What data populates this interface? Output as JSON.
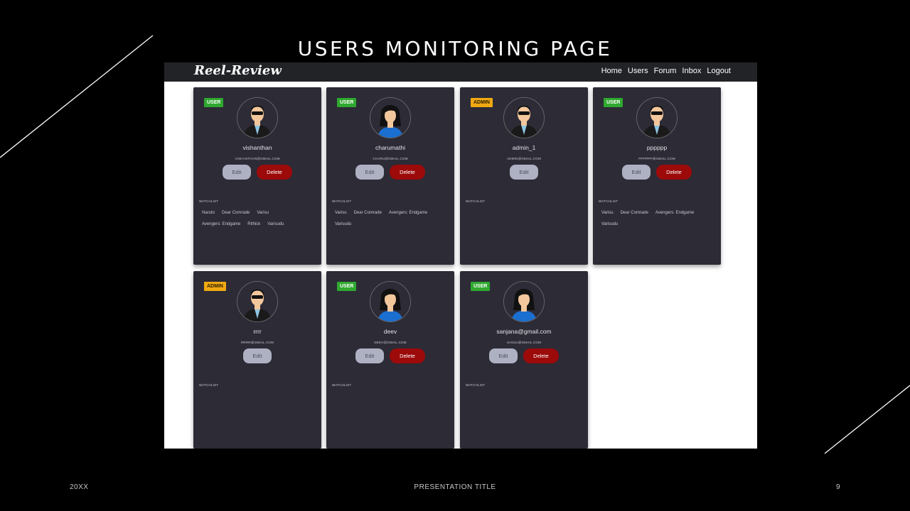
{
  "slide": {
    "title": "USERS MONITORING PAGE",
    "footer_left": "20XX",
    "footer_center": "PRESENTATION TITLE",
    "footer_right": "9"
  },
  "app": {
    "brand": "Reel-Review",
    "nav": [
      "Home",
      "Users",
      "Forum",
      "Inbox",
      "Logout"
    ],
    "edit_label": "Edit",
    "delete_label": "Delete",
    "watchlist_label": "WATCHLIST"
  },
  "users": [
    {
      "role": "USER",
      "avatar": "male-avatar-icon",
      "name": "vishanthan",
      "email": "VISHANTHAN@GMAIL.COM",
      "can_delete": true,
      "watchlist": [
        "Naruto",
        "Dear Comrade",
        "Varisu",
        "Avengers: Endgame",
        "Rithick",
        "Varisudu"
      ]
    },
    {
      "role": "USER",
      "avatar": "female-avatar-icon",
      "name": "charumathi",
      "email": "CHARU@GMAIL.COM",
      "can_delete": true,
      "watchlist": [
        "Varisu",
        "Dear Comrade",
        "Avengers: Endgame",
        "Varisudu"
      ]
    },
    {
      "role": "ADMIN",
      "avatar": "male-avatar-icon",
      "name": "admin_1",
      "email": "ADMIN@GMAIL.COM",
      "can_delete": false,
      "watchlist": []
    },
    {
      "role": "USER",
      "avatar": "male-avatar-icon",
      "name": "pppppp",
      "email": "PPPPPP@GMAIL.COM",
      "can_delete": true,
      "watchlist": [
        "Varisu",
        "Dear Comrade",
        "Avengers: Endgame",
        "Varisudu"
      ]
    },
    {
      "role": "ADMIN",
      "avatar": "male-avatar-icon",
      "name": "rrrr",
      "email": "RRRR@GMAIL.COM",
      "can_delete": false,
      "watchlist": []
    },
    {
      "role": "USER",
      "avatar": "female-avatar-icon",
      "name": "deev",
      "email": "DEEV@GMAIL.COM",
      "can_delete": true,
      "watchlist": []
    },
    {
      "role": "USER",
      "avatar": "female-avatar-icon",
      "name": "sanjana@gmail.com",
      "email": "SANJU@GMAIL.COM",
      "can_delete": true,
      "watchlist": []
    }
  ],
  "colors": {
    "slide_bg": "#000000",
    "card_bg": "#2c2b36",
    "badge_user": "#2fa82f",
    "badge_admin": "#f0a911",
    "delete": "#9c0a0a",
    "edit": "#aeb1c2"
  }
}
